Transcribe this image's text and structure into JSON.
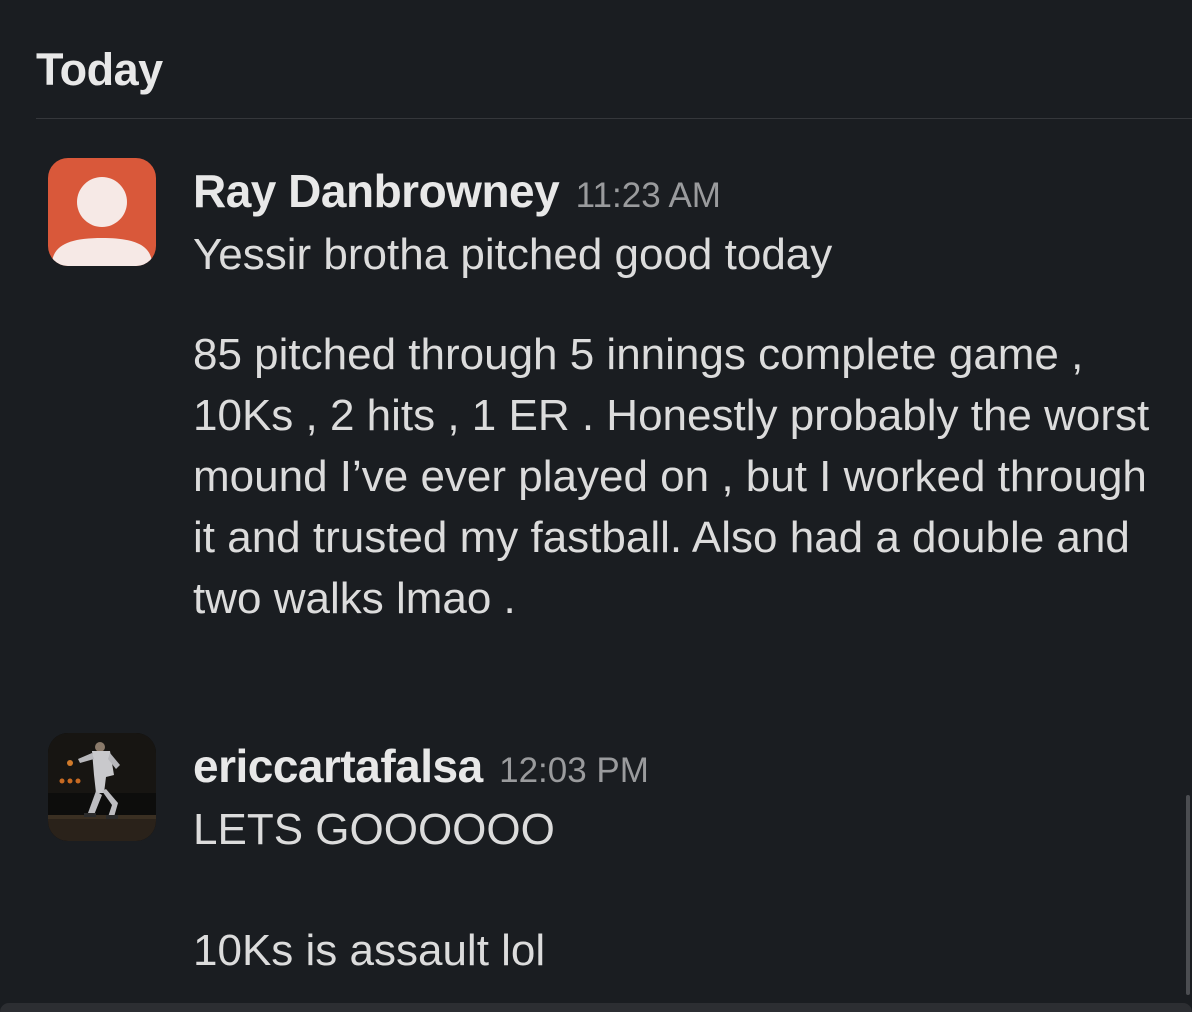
{
  "day_header": "Today",
  "messages": [
    {
      "author": "Ray Danbrowney",
      "time": "11:23 AM",
      "avatar": "default-user-icon",
      "paragraphs": [
        "Yessir brotha pitched good today",
        "85 pitched through 5 innings complete game , 10Ks , 2 hits , 1 ER . Honestly probably the worst mound I’ve ever played on , but I worked through it and trusted my fastball. Also had a double and two walks lmao ."
      ]
    },
    {
      "author": "ericcartafalsa",
      "time": "12:03 PM",
      "avatar": "photo-avatar",
      "paragraphs": [
        "LETS GOOOOOO",
        "10Ks is assault lol"
      ]
    }
  ],
  "colors": {
    "background": "#1a1d21",
    "default_avatar": "#d9583a"
  }
}
